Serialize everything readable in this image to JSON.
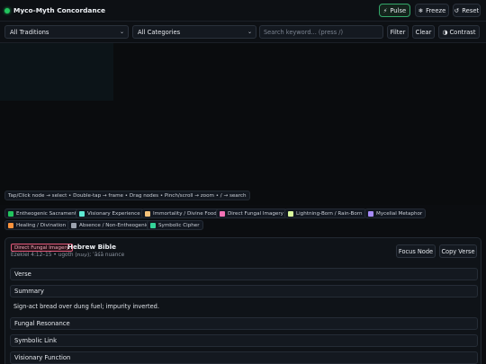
{
  "app": {
    "title": "Myco-Myth Concordance"
  },
  "toolbar": {
    "pulse_label": "Pulse",
    "freeze_label": "Freeze",
    "reset_label": "Reset"
  },
  "filters": {
    "tradition_value": "All Traditions",
    "category_value": "All Categories",
    "search_placeholder": "Search keyword... (press /)",
    "filter_label": "Filter",
    "clear_label": "Clear",
    "contrast_label": "Contrast"
  },
  "graph": {
    "hint": "Tap/Click node → select • Double-tap → frame • Drag nodes • Pinch/scroll → zoom • / → search"
  },
  "legend": [
    {
      "label": "Entheogenic Sacrament",
      "color": "#22c55e"
    },
    {
      "label": "Visionary Experience",
      "color": "#5eead4"
    },
    {
      "label": "Immortality / Divine Food",
      "color": "#f5c27a"
    },
    {
      "label": "Direct Fungal Imagery",
      "color": "#f472b6"
    },
    {
      "label": "Lightning-Born / Rain-Born",
      "color": "#d9f99d"
    },
    {
      "label": "Mycelial Metaphor",
      "color": "#a78bfa"
    },
    {
      "label": "Healing / Divination",
      "color": "#fb923c"
    },
    {
      "label": "Absence / Non-Entheogenic",
      "color": "#9ca3af"
    },
    {
      "label": "Symbolic Cipher",
      "color": "#34d399"
    }
  ],
  "detail": {
    "category_tag": "Direct Fungal Imagery",
    "source_title": "Hebrew Bible",
    "reference": "Ezekiel 4:12–15 • ugoth (עוגת); ʿāśā nuance",
    "focus_label": "Focus Node",
    "copy_label": "Copy Verse",
    "sections": {
      "verse": "Verse",
      "summary": "Summary",
      "fungal": "Fungal Resonance",
      "symbolic": "Symbolic Link",
      "visionary": "Visionary Function"
    },
    "summary_text": "Sign-act bread over dung fuel; impurity inverted."
  }
}
